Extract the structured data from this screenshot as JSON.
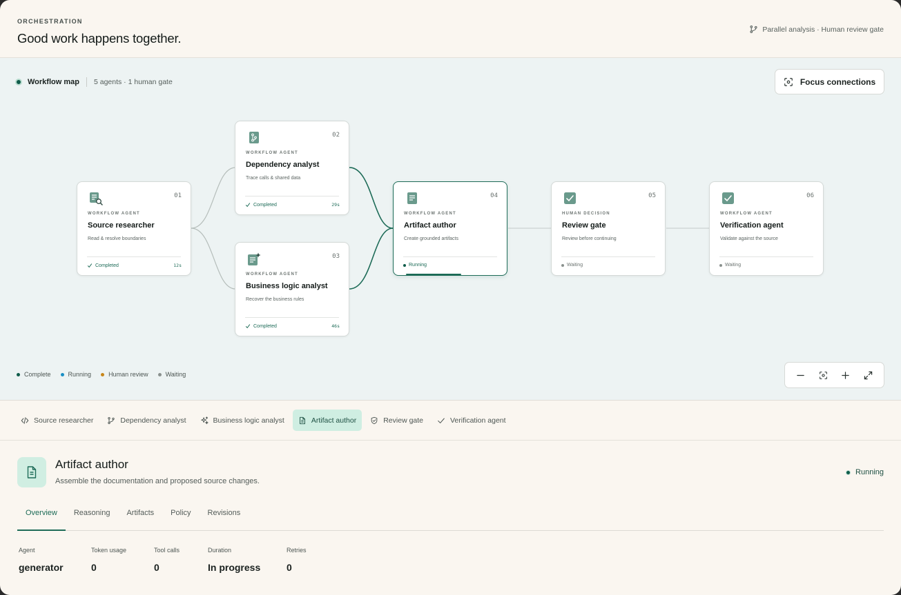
{
  "header": {
    "eyebrow": "ORCHESTRATION",
    "title": "Good work happens together.",
    "meta": "Parallel analysis · Human review gate"
  },
  "map": {
    "title": "Workflow map",
    "subtitle": "5 agents · 1 human gate",
    "focus_label": "Focus connections"
  },
  "nodes": [
    {
      "num": "01",
      "kind": "WORKFLOW AGENT",
      "title": "Source researcher",
      "desc": "Read & resolve boundaries",
      "status": "Completed",
      "time": "12s"
    },
    {
      "num": "02",
      "kind": "WORKFLOW AGENT",
      "title": "Dependency analyst",
      "desc": "Trace calls & shared data",
      "status": "Completed",
      "time": "29s"
    },
    {
      "num": "03",
      "kind": "WORKFLOW AGENT",
      "title": "Business logic analyst",
      "desc": "Recover the business rules",
      "status": "Completed",
      "time": "46s"
    },
    {
      "num": "04",
      "kind": "WORKFLOW AGENT",
      "title": "Artifact author",
      "desc": "Create grounded artifacts",
      "status": "Running",
      "time": "",
      "progress": 0.5
    },
    {
      "num": "05",
      "kind": "HUMAN DECISION",
      "title": "Review gate",
      "desc": "Review before continuing",
      "status": "Waiting",
      "time": ""
    },
    {
      "num": "06",
      "kind": "WORKFLOW AGENT",
      "title": "Verification agent",
      "desc": "Validate against the source",
      "status": "Waiting",
      "time": ""
    }
  ],
  "legend": [
    {
      "label": "Complete",
      "color": "#0f5c4a"
    },
    {
      "label": "Running",
      "color": "#1a8fc4"
    },
    {
      "label": "Human review",
      "color": "#c7861a"
    },
    {
      "label": "Waiting",
      "color": "#8a918e"
    }
  ],
  "agent_tabs": [
    {
      "label": "Source researcher",
      "icon": "code-icon"
    },
    {
      "label": "Dependency analyst",
      "icon": "branch-icon"
    },
    {
      "label": "Business logic analyst",
      "icon": "sparkle-icon"
    },
    {
      "label": "Artifact author",
      "icon": "document-icon",
      "selected": true
    },
    {
      "label": "Review gate",
      "icon": "shield-icon"
    },
    {
      "label": "Verification agent",
      "icon": "check-icon"
    }
  ],
  "detail": {
    "title": "Artifact author",
    "desc": "Assemble the documentation and proposed source changes.",
    "status": "Running",
    "tabs": [
      "Overview",
      "Reasoning",
      "Artifacts",
      "Policy",
      "Revisions"
    ],
    "selected_tab": "Overview",
    "stats": [
      {
        "label": "Agent",
        "value": "generator"
      },
      {
        "label": "Token usage",
        "value": "0"
      },
      {
        "label": "Tool calls",
        "value": "0"
      },
      {
        "label": "Duration",
        "value": "In progress"
      },
      {
        "label": "Retries",
        "value": "0"
      }
    ]
  },
  "colors": {
    "accent": "#1d6b57",
    "accent_soft": "#cfeee2",
    "canvas": "#edf3f3",
    "page": "#faf6f0"
  }
}
